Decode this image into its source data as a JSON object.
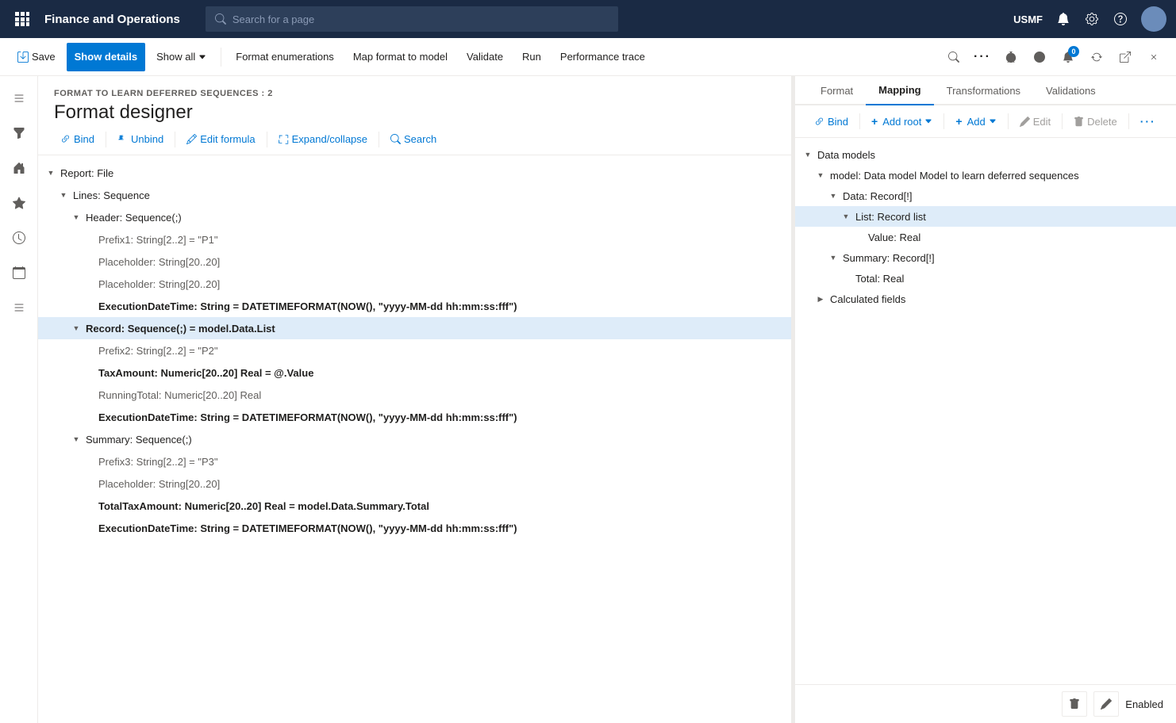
{
  "app": {
    "title": "Finance and Operations",
    "search_placeholder": "Search for a page",
    "user_org": "USMF"
  },
  "commandbar": {
    "save_label": "Save",
    "show_details_label": "Show details",
    "show_all_label": "Show all",
    "format_enumerations_label": "Format enumerations",
    "map_format_to_model_label": "Map format to model",
    "validate_label": "Validate",
    "run_label": "Run",
    "performance_trace_label": "Performance trace",
    "badge_count": "0"
  },
  "breadcrumb": "FORMAT TO LEARN DEFERRED SEQUENCES : 2",
  "page_title": "Format designer",
  "left_toolbar": {
    "bind_label": "Bind",
    "unbind_label": "Unbind",
    "edit_formula_label": "Edit formula",
    "expand_collapse_label": "Expand/collapse",
    "search_label": "Search"
  },
  "tree": [
    {
      "id": "report",
      "indent": "i0",
      "toggle": "down",
      "label": "Report: File",
      "bold": false,
      "muted": false
    },
    {
      "id": "lines",
      "indent": "i1",
      "toggle": "down",
      "label": "Lines: Sequence",
      "bold": false,
      "muted": false
    },
    {
      "id": "header",
      "indent": "i2",
      "toggle": "down",
      "label": "Header: Sequence(;)",
      "bold": false,
      "muted": false
    },
    {
      "id": "prefix1",
      "indent": "i3",
      "toggle": null,
      "label": "Prefix1: String[2..2] = \"P1\"",
      "bold": false,
      "muted": true
    },
    {
      "id": "placeholder1",
      "indent": "i3",
      "toggle": null,
      "label": "Placeholder: String[20..20]",
      "bold": false,
      "muted": true
    },
    {
      "id": "placeholder2",
      "indent": "i3",
      "toggle": null,
      "label": "Placeholder: String[20..20]",
      "bold": false,
      "muted": true
    },
    {
      "id": "execdate1",
      "indent": "i3",
      "toggle": null,
      "label": "ExecutionDateTime: String = DATETIMEFORMAT(NOW(), \"yyyy-MM-dd hh:mm:ss:fff\")",
      "bold": true,
      "muted": false
    },
    {
      "id": "record",
      "indent": "i2",
      "toggle": "down",
      "label": "Record: Sequence(;) = model.Data.List",
      "bold": true,
      "muted": false,
      "selected": true
    },
    {
      "id": "prefix2",
      "indent": "i3",
      "toggle": null,
      "label": "Prefix2: String[2..2] = \"P2\"",
      "bold": false,
      "muted": true
    },
    {
      "id": "taxamount",
      "indent": "i3",
      "toggle": null,
      "label": "TaxAmount: Numeric[20..20] Real = @.Value",
      "bold": true,
      "muted": false
    },
    {
      "id": "runningtotal",
      "indent": "i3",
      "toggle": null,
      "label": "RunningTotal: Numeric[20..20] Real",
      "bold": false,
      "muted": true
    },
    {
      "id": "execdate2",
      "indent": "i3",
      "toggle": null,
      "label": "ExecutionDateTime: String = DATETIMEFORMAT(NOW(), \"yyyy-MM-dd hh:mm:ss:fff\")",
      "bold": true,
      "muted": false
    },
    {
      "id": "summary",
      "indent": "i2",
      "toggle": "down",
      "label": "Summary: Sequence(;)",
      "bold": false,
      "muted": false
    },
    {
      "id": "prefix3",
      "indent": "i3",
      "toggle": null,
      "label": "Prefix3: String[2..2] = \"P3\"",
      "bold": false,
      "muted": true
    },
    {
      "id": "placeholder3",
      "indent": "i3",
      "toggle": null,
      "label": "Placeholder: String[20..20]",
      "bold": false,
      "muted": true
    },
    {
      "id": "totaltax",
      "indent": "i3",
      "toggle": null,
      "label": "TotalTaxAmount: Numeric[20..20] Real = model.Data.Summary.Total",
      "bold": true,
      "muted": false
    },
    {
      "id": "execdate3",
      "indent": "i3",
      "toggle": null,
      "label": "ExecutionDateTime: String = DATETIMEFORMAT(NOW(), \"yyyy-MM-dd hh:mm:ss:fff\")",
      "bold": true,
      "muted": false
    }
  ],
  "right_panel": {
    "tabs": [
      "Format",
      "Mapping",
      "Transformations",
      "Validations"
    ],
    "active_tab": "Mapping",
    "toolbar": {
      "bind_label": "Bind",
      "add_root_label": "Add root",
      "add_label": "Add",
      "edit_label": "Edit",
      "delete_label": "Delete"
    }
  },
  "model_tree": [
    {
      "id": "data_models",
      "indent": "mi0",
      "toggle": "down",
      "label": "Data models",
      "bold": false,
      "selected": false
    },
    {
      "id": "model_node",
      "indent": "mi1",
      "toggle": "down",
      "label": "model: Data model Model to learn deferred sequences",
      "bold": false,
      "selected": false
    },
    {
      "id": "data_record",
      "indent": "mi2",
      "toggle": "down",
      "label": "Data: Record[!]",
      "bold": false,
      "selected": false
    },
    {
      "id": "list_record",
      "indent": "mi3",
      "toggle": "down",
      "label": "List: Record list",
      "bold": false,
      "selected": true
    },
    {
      "id": "value_real",
      "indent": "mi4",
      "toggle": null,
      "label": "Value: Real",
      "bold": false,
      "muted": false
    },
    {
      "id": "summary_record",
      "indent": "mi2",
      "toggle": "down",
      "label": "Summary: Record[!]",
      "bold": false,
      "selected": false
    },
    {
      "id": "total_real",
      "indent": "mi3",
      "toggle": null,
      "label": "Total: Real",
      "bold": false,
      "muted": false
    },
    {
      "id": "calc_fields",
      "indent": "mi1",
      "toggle": "right",
      "label": "Calculated fields",
      "bold": false,
      "selected": false
    }
  ],
  "bottom_bar": {
    "enabled_label": "Enabled"
  }
}
